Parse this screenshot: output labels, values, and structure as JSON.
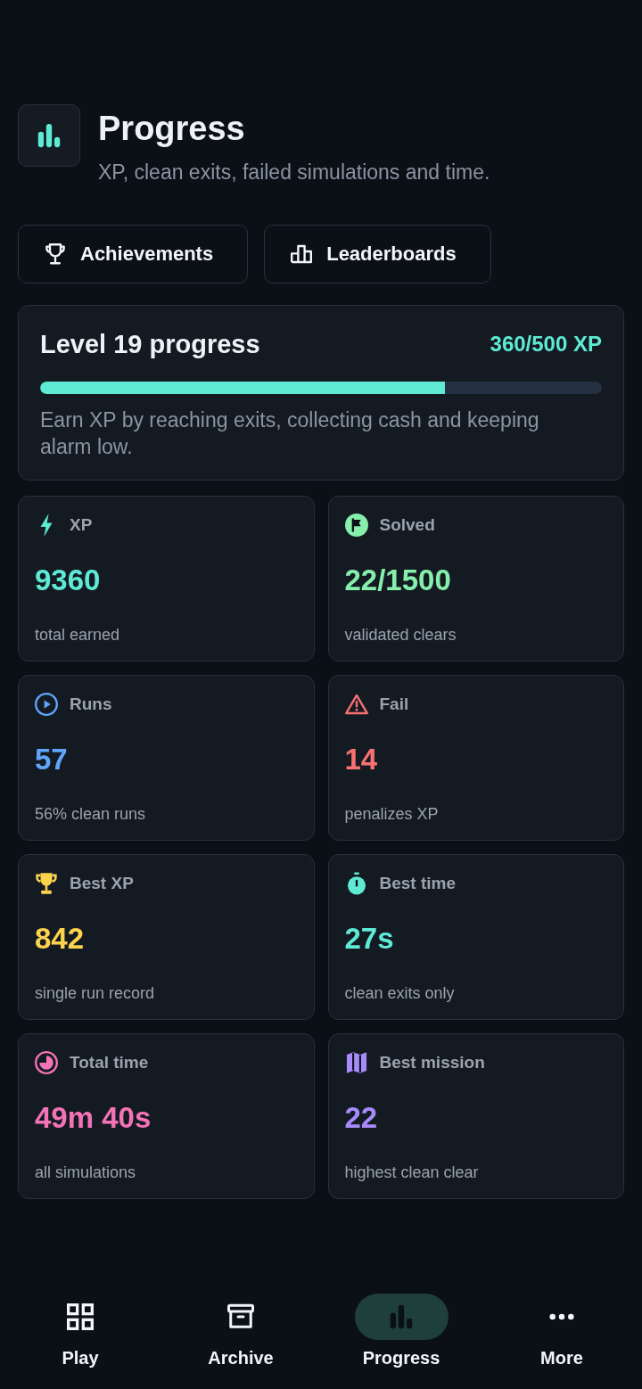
{
  "header": {
    "title": "Progress",
    "subtitle": "XP, clean exits, failed simulations and time."
  },
  "actions": [
    {
      "label": "Achievements"
    },
    {
      "label": "Leaderboards"
    }
  ],
  "level_card": {
    "title": "Level 19 progress",
    "xp": "360/500 XP",
    "level": 0.72,
    "description": "Earn XP by reaching exits, collecting cash and keeping alarm low."
  },
  "stats": [
    {
      "label": "XP",
      "value": "9360",
      "caption": "total earned",
      "color": "#5eead4"
    },
    {
      "label": "Solved",
      "value": "22/1500",
      "caption": "validated clears",
      "color": "#86efac"
    },
    {
      "label": "Runs",
      "value": "57",
      "caption": "56% clean runs",
      "color": "#60a5fa"
    },
    {
      "label": "Fail",
      "value": "14",
      "caption": "penalizes XP",
      "color": "#f87171"
    },
    {
      "label": "Best XP",
      "value": "842",
      "caption": "single run record",
      "color": "#fcd34d"
    },
    {
      "label": "Best time",
      "value": "27s",
      "caption": "clean exits only",
      "color": "#5eead4"
    },
    {
      "label": "Total time",
      "value": "49m 40s",
      "caption": "all simulations",
      "color": "#f472b6"
    },
    {
      "label": "Best mission",
      "value": "22",
      "caption": "highest clean clear",
      "color": "#a78bfa"
    }
  ],
  "nav": [
    {
      "label": "Play",
      "selected": false
    },
    {
      "label": "Archive",
      "selected": false
    },
    {
      "label": "Progress",
      "selected": true
    },
    {
      "label": "More",
      "selected": false
    }
  ]
}
